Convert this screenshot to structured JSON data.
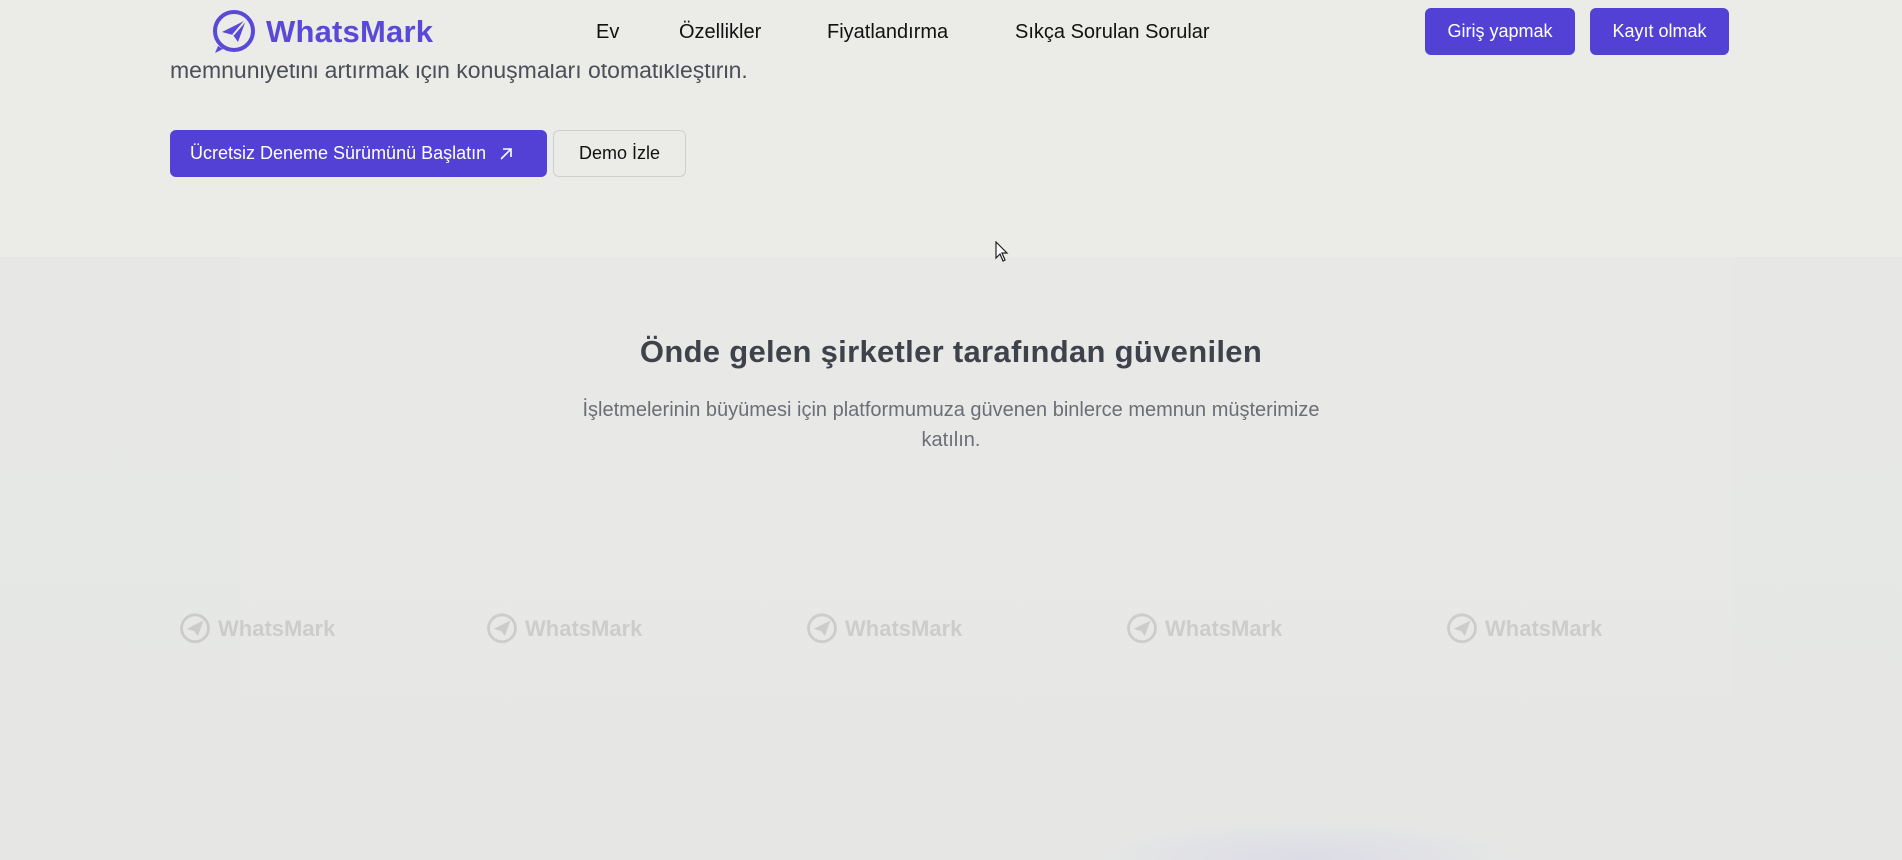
{
  "hero": {
    "cut_text": "memnuniyetini artırmak için konuşmaları otomatikleştirin.",
    "trial_button": "Ücretsiz Deneme Sürümünü Başlatın",
    "demo_button": "Demo İzle"
  },
  "header": {
    "brand": "WhatsMark",
    "nav": [
      "Ev",
      "Özellikler",
      "Fiyatlandırma",
      "Sıkça Sorulan Sorular"
    ],
    "login_button": "Giriş yapmak",
    "signup_button": "Kayıt olmak"
  },
  "trusted": {
    "title": "Önde gelen şirketler tarafından güvenilen",
    "subtitle": "İşletmelerinin büyümesi için platformumuza güvenen binlerce memnun müşterimize katılın.",
    "logos": [
      "WhatsMark",
      "WhatsMark",
      "WhatsMark",
      "WhatsMark",
      "WhatsMark"
    ]
  },
  "colors": {
    "brand": "#5341d6",
    "brand_text": "#5a49d6",
    "background": "#ebebe8"
  },
  "icons": {
    "brand_logo": "paper-plane-chat-icon",
    "trial_arrow": "arrow-up-right-icon",
    "cursor": "mouse-pointer-icon"
  }
}
